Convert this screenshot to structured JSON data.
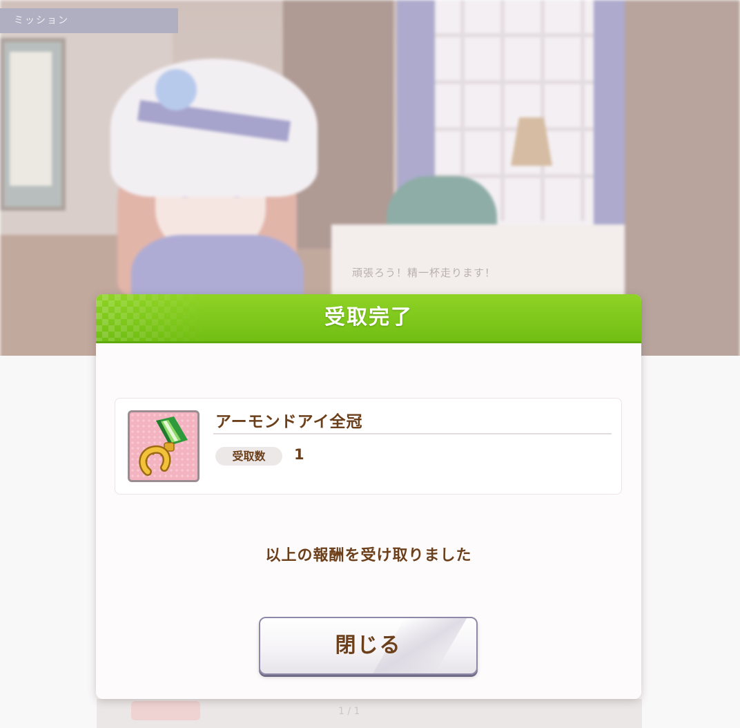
{
  "background": {
    "top_tab_label": "ミッション",
    "board_text": "頑張ろう！精一杯走ります！",
    "page_indicator": "1 / 1"
  },
  "dialog": {
    "title": "受取完了",
    "reward": {
      "icon": "horseshoe-medal-icon",
      "name": "アーモンドアイ全冠",
      "quantity_label": "受取数",
      "quantity_value": "1"
    },
    "message": "以上の報酬を受け取りました",
    "close_label": "閉じる"
  },
  "colors": {
    "header_green": "#7cc61b",
    "text_brown": "#6c3f1b",
    "icon_pink": "#f3b3c0",
    "button_border": "#8d88a8"
  }
}
